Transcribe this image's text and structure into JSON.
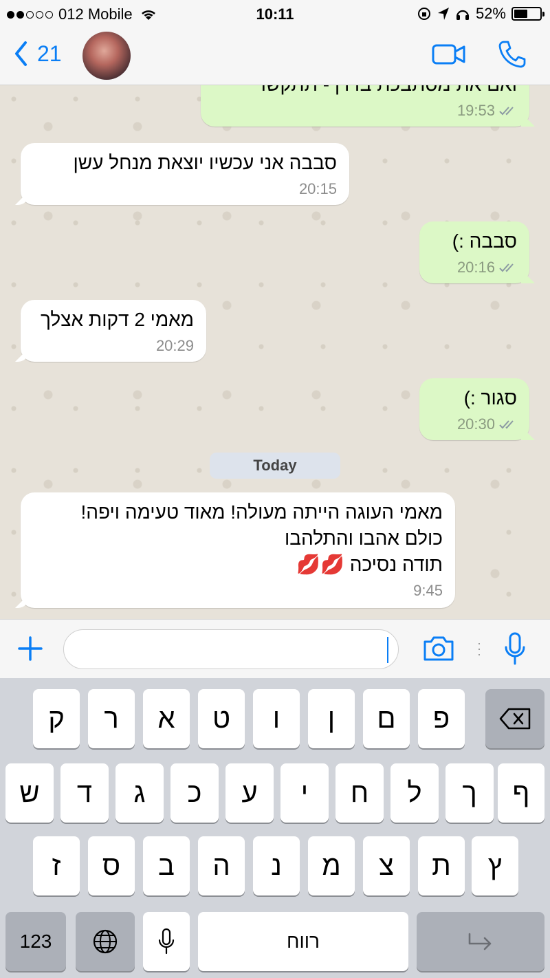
{
  "status_bar": {
    "carrier": "012 Mobile",
    "time": "10:11",
    "battery": "52%",
    "battery_level": 0.52
  },
  "nav": {
    "back_count": "21"
  },
  "messages": [
    {
      "direction": "out",
      "text": "ואם את מסתבכת בדרך- תתקשרי",
      "time": "19:53"
    },
    {
      "direction": "in",
      "text": "סבבה אני עכשיו יוצאת מנחל עשן",
      "time": "20:15"
    },
    {
      "direction": "out",
      "text": "סבבה :)",
      "time": "20:16"
    },
    {
      "direction": "in",
      "text": "מאמי 2 דקות אצלך",
      "time": "20:29"
    },
    {
      "direction": "out",
      "text": "סגור :)",
      "time": "20:30"
    },
    {
      "direction": "in",
      "text": "מאמי העוגה הייתה מעולה! מאוד טעימה ויפה!\nכולם אהבו והתלהבו\nתודה נסיכה 💋💋",
      "time": "9:45"
    }
  ],
  "day_separator": "Today",
  "keyboard": {
    "row1": [
      "ק",
      "ר",
      "א",
      "ט",
      "ו",
      "ן",
      "ם",
      "פ"
    ],
    "row2": [
      "ש",
      "ד",
      "ג",
      "כ",
      "ע",
      "י",
      "ח",
      "ל",
      "ך",
      "ף"
    ],
    "row3": [
      "ז",
      "ס",
      "ב",
      "ה",
      "נ",
      "מ",
      "צ",
      "ת",
      "ץ"
    ],
    "numbers_key": "123",
    "space_key": "רווח"
  },
  "colors": {
    "accent": "#0a7ef5",
    "outgoing_bubble": "#dcf8c6",
    "incoming_bubble": "#ffffff",
    "chat_background": "#e7e2d9"
  }
}
